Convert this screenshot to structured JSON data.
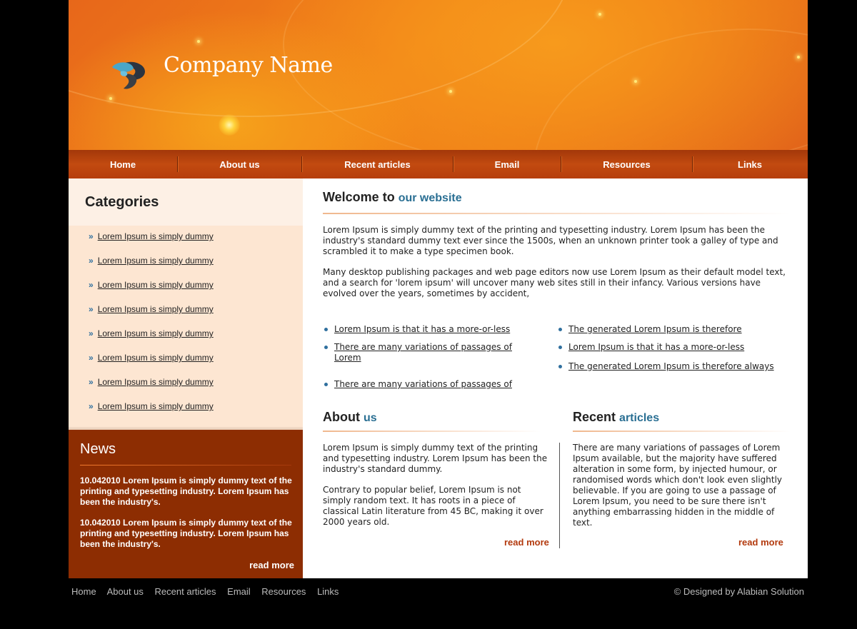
{
  "header": {
    "company_name": "Company Name",
    "logo_icon": "company-logo-icon",
    "accent_color": "#ee7a17"
  },
  "nav": {
    "items": [
      "Home",
      "About us",
      "Recent articles",
      "Email",
      "Resources",
      "Links"
    ]
  },
  "sidebar": {
    "categories_title": "Categories",
    "categories": [
      "Lorem Ipsum is simply dummy",
      "Lorem Ipsum is simply dummy",
      "Lorem Ipsum is simply dummy",
      "Lorem Ipsum is simply dummy",
      "Lorem Ipsum is simply dummy",
      "Lorem Ipsum is simply dummy",
      "Lorem Ipsum is simply dummy",
      "Lorem Ipsum is simply dummy"
    ],
    "news_title": "News",
    "news_items": [
      "10.042010 Lorem Ipsum is simply dummy text of the printing and typesetting industry. Lorem Ipsum has been the industry's.",
      "10.042010 Lorem Ipsum is simply dummy text of the printing and typesetting industry. Lorem Ipsum has been the industry's."
    ],
    "news_read_more": "read more",
    "news_bg": "#8d2d02"
  },
  "main": {
    "welcome_title": "Welcome to",
    "welcome_sub": "our website",
    "intro_p1": "Lorem Ipsum is simply dummy text of the printing and typesetting industry. Lorem Ipsum has been the industry's standard dummy text ever since the 1500s, when an unknown printer took a galley of type and scrambled it to make a type specimen book.",
    "intro_p2": "Many desktop publishing packages and web page editors now use Lorem Ipsum as their default model text, and a search for 'lorem ipsum' will uncover many web sites still in their infancy. Various versions have evolved over the years, sometimes by accident,",
    "links_left": [
      "Lorem Ipsum is that it has a more-or-less",
      "There are many variations of passages of Lorem",
      "There are many variations of passages of"
    ],
    "links_right": [
      "The generated Lorem Ipsum is therefore",
      "Lorem Ipsum is that it has a more-or-less",
      "The generated Lorem Ipsum is therefore always"
    ],
    "about_title": "About",
    "about_sub": "us",
    "about_p1": "Lorem Ipsum is simply dummy text of the printing and typesetting industry. Lorem Ipsum has been the industry's standard dummy.",
    "about_p2": "Contrary to popular belief, Lorem Ipsum is not simply random text. It has roots in a piece of classical Latin literature from 45 BC, making it over 2000 years old.",
    "about_read_more": "read more",
    "recent_title": "Recent",
    "recent_sub": "articles",
    "recent_p": "There are many variations of passages of Lorem Ipsum available, but the majority have suffered alteration in some form, by injected humour, or randomised words which don't look even slightly believable. If you are going to use a passage of Lorem Ipsum, you need to be sure there isn't anything embarrassing hidden in the middle of text.",
    "recent_read_more": "read more"
  },
  "footer": {
    "links": [
      "Home",
      "About us",
      "Recent articles",
      "Email",
      "Resources",
      "Links"
    ],
    "credit": "© Designed by  Alabian Solution"
  }
}
